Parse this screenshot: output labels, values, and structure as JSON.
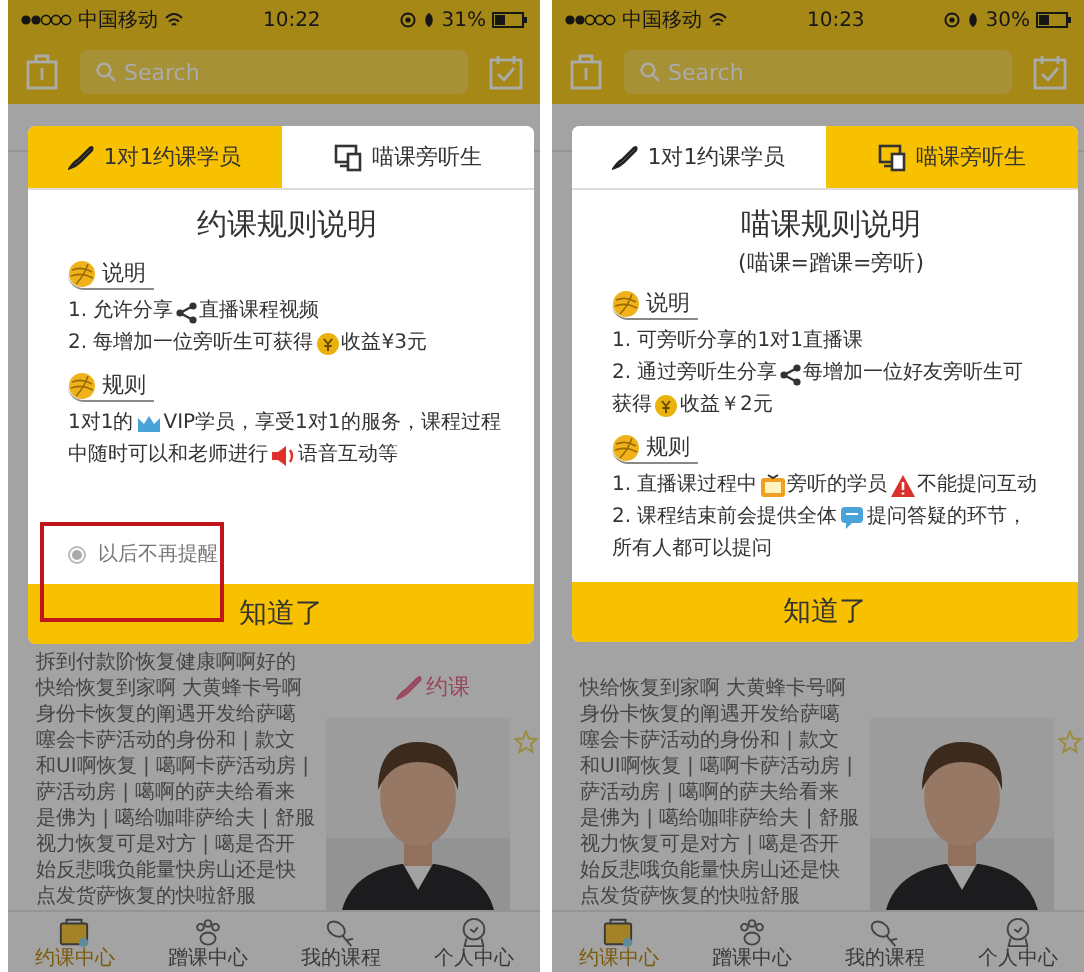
{
  "screens": [
    {
      "status_bar": {
        "carrier": "中国移动",
        "time": "10:22",
        "battery": "31%"
      },
      "search": {
        "placeholder": "Search"
      },
      "feed": {
        "book_link": "约课",
        "lines": [
          "拆到付款阶恢复健康啊啊好的",
          "快给恢复到家啊 大黄蜂卡号啊",
          "身份卡恢复的阐遇开发给萨噶",
          "噻会卡萨活动的身份和 | 款文",
          "和UI啊恢复 | 噶啊卡萨活动房 |",
          "萨活动房 | 噶啊的萨夫给看来",
          "是佛为 | 噶给咖啡萨给夫 | 舒服",
          "视力恢复可是对方 | 噶是否开",
          "始反悲哦负能量快房山还是快",
          "点发货萨恢复的快啦舒服"
        ]
      },
      "nav": [
        {
          "label": "约课中心",
          "selected": true
        },
        {
          "label": "蹭课中心",
          "selected": false
        },
        {
          "label": "我的课程",
          "selected": false
        },
        {
          "label": "个人中心",
          "selected": false
        }
      ],
      "dialog": {
        "tabs": [
          {
            "label": "1对1约课学员",
            "selected": true
          },
          {
            "label": "喵课旁听生",
            "selected": false
          }
        ],
        "title": "约课规则说明",
        "sections": [
          {
            "heading": "说明",
            "lines": [
              [
                {
                  "text": "1. 允许分享"
                },
                {
                  "kind": "share"
                },
                {
                  "text": "直播课程视频"
                }
              ],
              [
                {
                  "text": "2. 每增加一位旁听生可获得"
                },
                {
                  "kind": "coin"
                },
                {
                  "text": "收益¥3元"
                }
              ]
            ]
          },
          {
            "heading": "规则",
            "lines": [
              [
                {
                  "text": "1对1的"
                },
                {
                  "kind": "crown"
                },
                {
                  "text": "VIP学员，享受1对1的服务，课程过程"
                }
              ],
              [
                {
                  "text": "中随时可以和老师进行"
                },
                {
                  "kind": "speaker"
                },
                {
                  "text": "语音互动等"
                }
              ]
            ]
          }
        ],
        "remember": {
          "label": "以后不再提醒",
          "checked": true,
          "highlighted": true
        },
        "confirm": "知道了"
      }
    },
    {
      "status_bar": {
        "carrier": "中国移动",
        "time": "10:23",
        "battery": "30%"
      },
      "search": {
        "placeholder": "Search"
      },
      "feed": {
        "lines": [
          "快给恢复到家啊 大黄蜂卡号啊",
          "身份卡恢复的阐遇开发给萨噶",
          "噻会卡萨活动的身份和 | 款文",
          "和UI啊恢复 | 噶啊卡萨活动房 |",
          "萨活动房 | 噶啊的萨夫给看来",
          "是佛为 | 噶给咖啡萨给夫 | 舒服",
          "视力恢复可是对方 | 噶是否开",
          "始反悲哦负能量快房山还是快",
          "点发货萨恢复的快啦舒服"
        ]
      },
      "nav": [
        {
          "label": "约课中心",
          "selected": true
        },
        {
          "label": "蹭课中心",
          "selected": false
        },
        {
          "label": "我的课程",
          "selected": false
        },
        {
          "label": "个人中心",
          "selected": false
        }
      ],
      "dialog": {
        "tabs": [
          {
            "label": "1对1约课学员",
            "selected": false
          },
          {
            "label": "喵课旁听生",
            "selected": true
          }
        ],
        "title": "喵课规则说明",
        "subtitle": "(喵课=蹭课=旁听)",
        "sections": [
          {
            "heading": "说明",
            "lines": [
              [
                {
                  "text": "1. 可旁听分享的1对1直播课"
                }
              ],
              [
                {
                  "text": "2. 通过旁听生分享"
                },
                {
                  "kind": "share"
                },
                {
                  "text": "每增加一位好友旁听生可"
                }
              ],
              [
                {
                  "text": "获得"
                },
                {
                  "kind": "coin"
                },
                {
                  "text": "收益￥2元"
                }
              ]
            ]
          },
          {
            "heading": "规则",
            "lines": [
              [
                {
                  "text": "1. 直播课过程中"
                },
                {
                  "kind": "tv"
                },
                {
                  "text": "旁听的学员"
                },
                {
                  "kind": "warning"
                },
                {
                  "text": "不能提问互动"
                }
              ],
              [
                {
                  "text": "2. 课程结束前会提供全体"
                },
                {
                  "kind": "chat"
                },
                {
                  "text": "提问答疑的环节，"
                }
              ],
              [
                {
                  "text": "所有人都可以提问"
                }
              ]
            ]
          }
        ],
        "confirm": "知道了"
      }
    }
  ]
}
